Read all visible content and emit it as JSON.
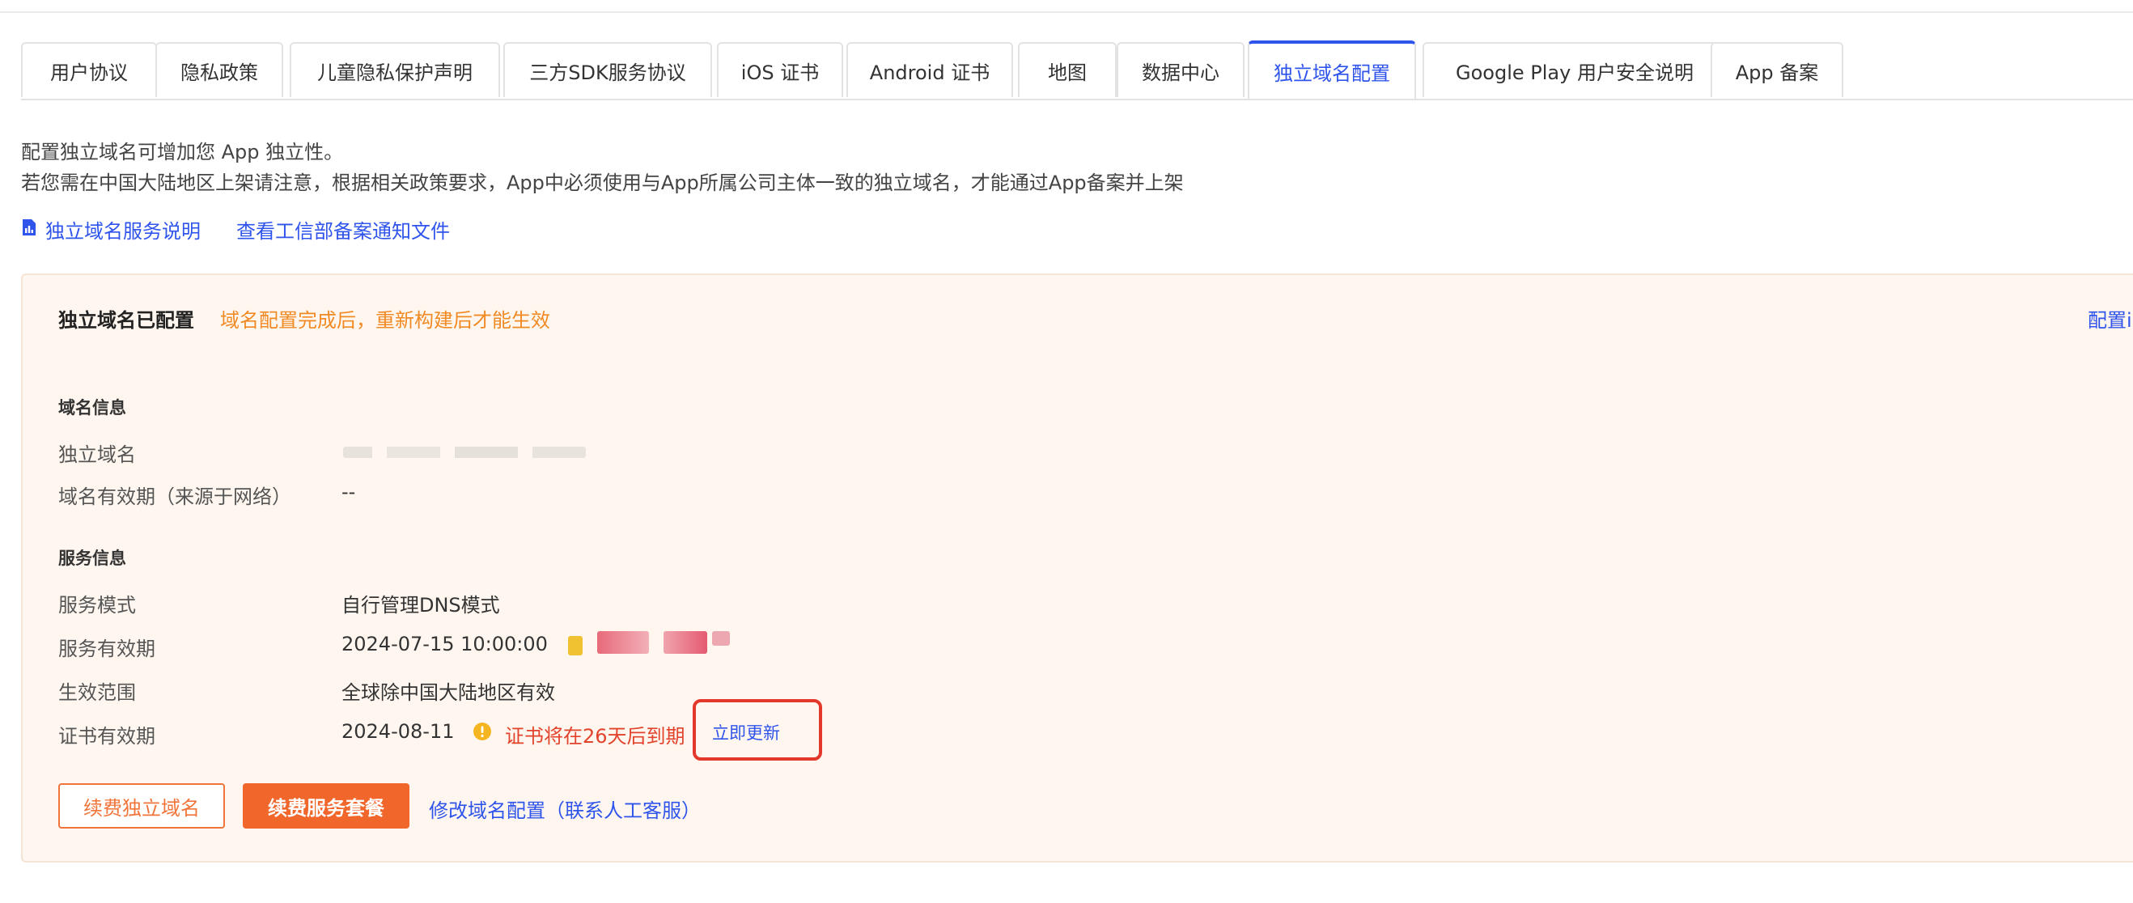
{
  "tabs": [
    {
      "label": "用户协议"
    },
    {
      "label": "隐私政策"
    },
    {
      "label": "儿童隐私保护声明"
    },
    {
      "label": "三方SDK服务协议"
    },
    {
      "label": "iOS 证书"
    },
    {
      "label": "Android 证书"
    },
    {
      "label": "地图"
    },
    {
      "label": "数据中心"
    },
    {
      "label": "独立域名配置",
      "active": true
    },
    {
      "label": "Google Play 用户安全说明"
    },
    {
      "label": "App 备案"
    }
  ],
  "intro": {
    "line1": "配置独立域名可增加您 App 独立性。",
    "line2": "若您需在中国大陆地区上架请注意，根据相关政策要求，App中必须使用与App所属公司主体一致的独立域名，才能通过App备案并上架"
  },
  "links": {
    "service_doc": "独立域名服务说明",
    "miit_notice": "查看工信部备案通知文件"
  },
  "panel": {
    "title": "独立域名已配置",
    "hint": "域名配置完成后，重新构建后才能生效",
    "config_link": "配置i",
    "domain_section": "域名信息",
    "domain_label": "独立域名",
    "domain_value": "",
    "domain_validity_label": "域名有效期（来源于网络）",
    "domain_validity_value": "--",
    "service_section": "服务信息",
    "service_mode_label": "服务模式",
    "service_mode_value": "自行管理DNS模式",
    "service_validity_label": "服务有效期",
    "service_validity_value": "2024-07-15 10:00:00",
    "scope_label": "生效范围",
    "scope_value": "全球除中国大陆地区有效",
    "cert_label": "证书有效期",
    "cert_value": "2024-08-11",
    "cert_warning": "证书将在26天后到期",
    "update_now": "立即更新",
    "renew_domain": "续费独立域名",
    "renew_package": "续费服务套餐",
    "modify_config": "修改域名配置（联系人工客服）"
  },
  "colors": {
    "accent": "#2f54eb",
    "orange": "#f1662a",
    "warning_red": "#e2432c",
    "panel_bg": "#fff7ef",
    "hint_orange": "#f08a24"
  },
  "icons": {
    "doc_icon": "document-chart-icon",
    "warning_icon": "exclamation-circle-icon",
    "status_icon": "yellow-tag-icon"
  }
}
